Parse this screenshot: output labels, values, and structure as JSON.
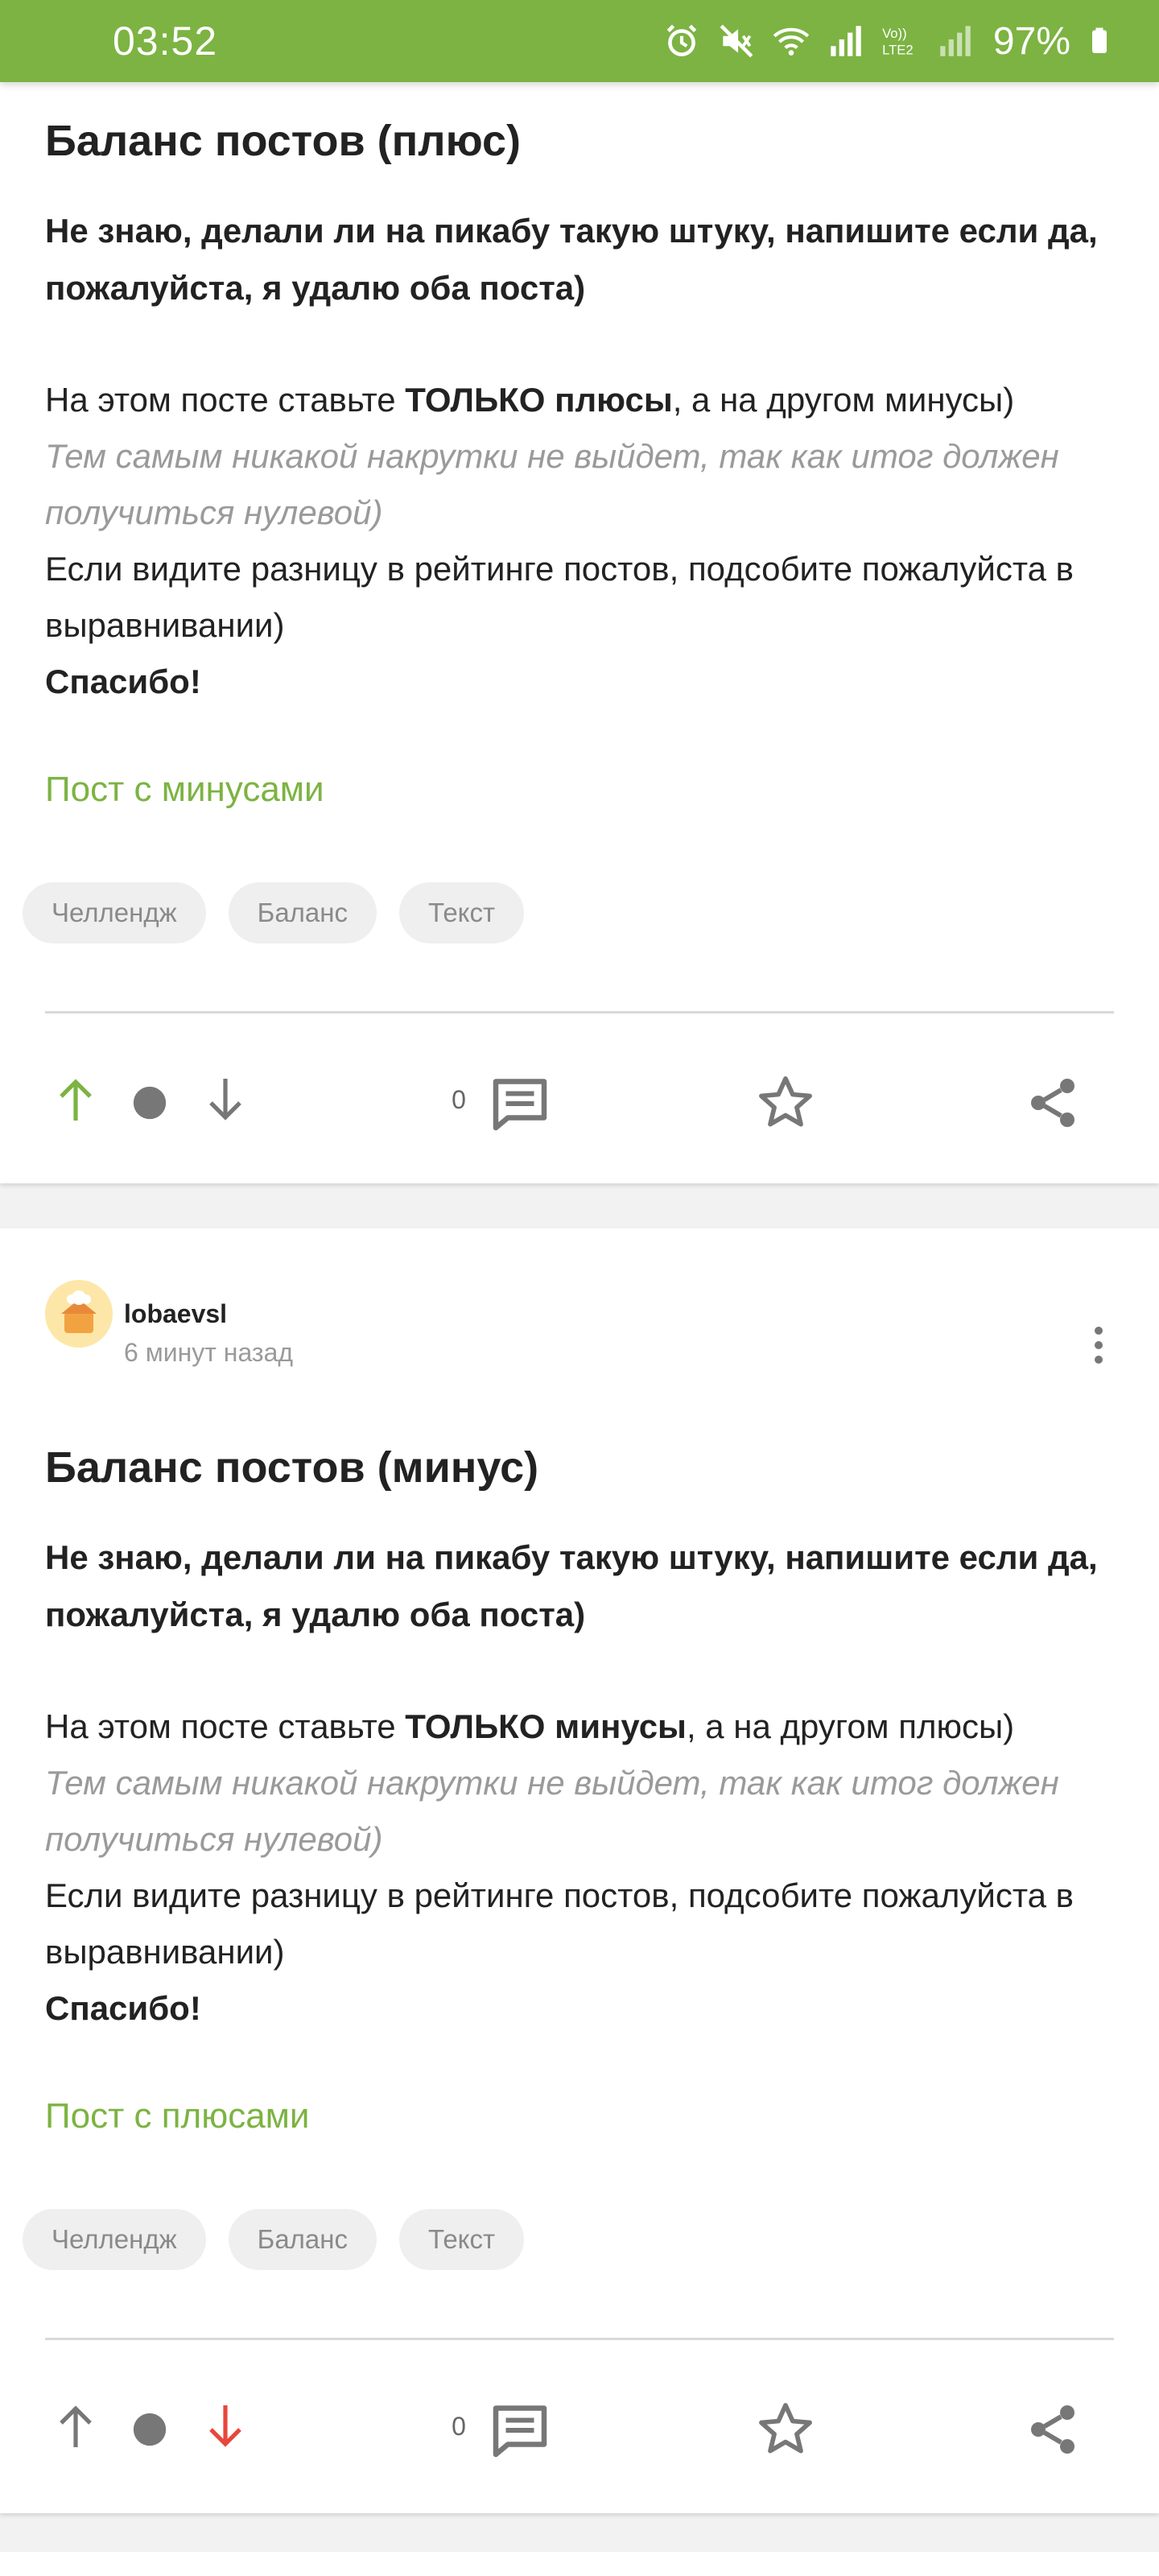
{
  "status_bar": {
    "time": "03:52",
    "battery": "97%",
    "icons": [
      "alarm-icon",
      "mute-icon",
      "wifi-icon",
      "signal-icon",
      "volte-icon",
      "signal2-icon",
      "battery-icon"
    ],
    "volte_label": "Vo)) LTE2"
  },
  "colors": {
    "accent": "#7cb342",
    "downvote": "#e8473b",
    "muted": "#9a9a9a"
  },
  "posts": [
    {
      "title": "Баланс постов (плюс)",
      "intro": "Не знаю, делали ли на пикабу такую штуку, напишите если да, пожалуйста, я удалю оба поста)",
      "line1_pre": "На этом посте ставьте ",
      "line1_bold": "ТОЛЬКО плюсы",
      "line1_post": ", а на другом минусы)",
      "muted": "Тем самым никакой накрутки не выйдет, так как итог должен получиться нулевой)",
      "line3": "Если видите разницу в рейтинге постов, подсобите пожалуйста в выравнивании)",
      "thanks": "Спасибо!",
      "link": "Пост с минусами",
      "tags": [
        "Челлендж",
        "Баланс",
        "Текст"
      ],
      "comments": "0",
      "vote_state": "up"
    },
    {
      "author": "lobaevsl",
      "time": "6 минут назад",
      "title": "Баланс постов (минус)",
      "intro": "Не знаю, делали ли на пикабу такую штуку, напишите если да, пожалуйста, я удалю оба поста)",
      "line1_pre": "На этом посте ставьте ",
      "line1_bold": "ТОЛЬКО минусы",
      "line1_post": ", а на другом плюсы)",
      "muted": "Тем самым никакой накрутки не выйдет, так как итог должен получиться нулевой)",
      "line3": "Если видите разницу в рейтинге постов, подсобите пожалуйста в выравнивании)",
      "thanks": "Спасибо!",
      "link": "Пост с плюсами",
      "tags": [
        "Челлендж",
        "Баланс",
        "Текст"
      ],
      "comments": "0",
      "vote_state": "down"
    }
  ]
}
